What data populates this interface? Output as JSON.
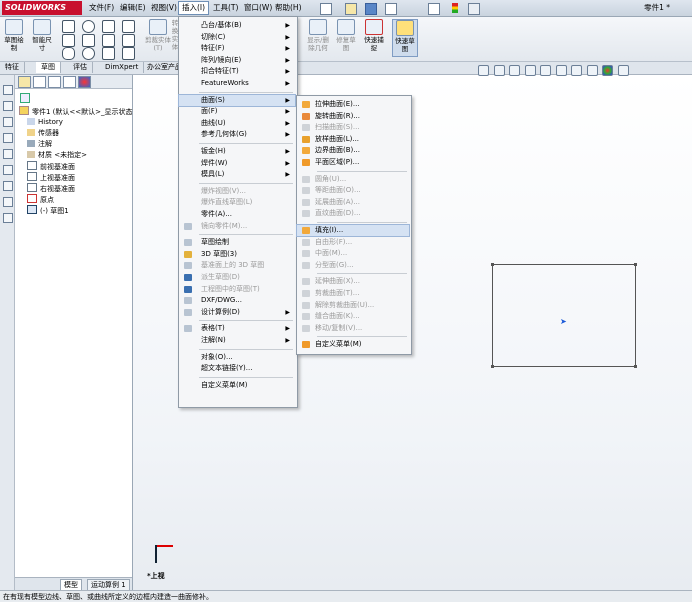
{
  "app": {
    "logo": "SOLIDWORKS",
    "document_title": "零件1 *"
  },
  "menubar": [
    "文件(F)",
    "编辑(E)",
    "视图(V)",
    "插入(I)",
    "工具(T)",
    "窗口(W)",
    "帮助(H)"
  ],
  "commands": {
    "sketch": "草图绘制",
    "smart_dim": "智能尺寸",
    "trim": "剪裁实体(T)",
    "convert": "转换实体",
    "display_delete": "显示/删除几何",
    "repair_sketch": "修复草图",
    "quick_snap": "快速捕捉",
    "rapid_sketch": "快速草图"
  },
  "tabs": [
    "特征",
    "草图",
    "评估",
    "DimXpert",
    "办公室产品"
  ],
  "tree": {
    "root": "零件1 (默认<<默认>_显示状态",
    "items": [
      "History",
      "传感器",
      "注解",
      "材质 <未指定>",
      "前视基准面",
      "上视基准面",
      "右视基准面",
      "原点",
      "(-) 草图1"
    ],
    "bottom_tabs": [
      "模型",
      "运动算例 1"
    ]
  },
  "insert_menu": [
    {
      "label": "凸台/基体(B)",
      "sub": true
    },
    {
      "label": "切除(C)",
      "sub": true
    },
    {
      "label": "特征(F)",
      "sub": true
    },
    {
      "label": "阵列/镜向(E)",
      "sub": true
    },
    {
      "label": "扣合特征(T)",
      "sub": true
    },
    {
      "label": "FeatureWorks",
      "sub": true
    },
    {
      "sep": true
    },
    {
      "label": "曲面(S)",
      "sub": true,
      "hl": true
    },
    {
      "label": "面(F)",
      "sub": true
    },
    {
      "label": "曲线(U)",
      "sub": true
    },
    {
      "label": "参考几何体(G)",
      "sub": true
    },
    {
      "sep": true
    },
    {
      "label": "钣金(H)",
      "sub": true
    },
    {
      "label": "焊件(W)",
      "sub": true
    },
    {
      "label": "模具(L)",
      "sub": true
    },
    {
      "sep": true
    },
    {
      "label": "爆炸视图(V)...",
      "dis": true
    },
    {
      "label": "爆炸直线草图(L)",
      "dis": true
    },
    {
      "label": "零件(A)..."
    },
    {
      "label": "镜向零件(M)...",
      "dis": true
    },
    {
      "sep": true
    },
    {
      "label": "草图绘制"
    },
    {
      "label": "3D 草图(3)"
    },
    {
      "label": "基准面上的 3D 草图",
      "dis": true
    },
    {
      "label": "派生草图(D)",
      "dis": true
    },
    {
      "label": "工程图中的草图(T)",
      "dis": true
    },
    {
      "label": "DXF/DWG..."
    },
    {
      "label": "设计算例(D)",
      "sub": true
    },
    {
      "sep": true
    },
    {
      "label": "表格(T)",
      "sub": true
    },
    {
      "label": "注解(N)",
      "sub": true
    },
    {
      "sep": true
    },
    {
      "label": "对象(O)..."
    },
    {
      "label": "超文本链接(Y)..."
    },
    {
      "sep": true
    },
    {
      "label": "自定义菜单(M)"
    }
  ],
  "surface_menu": [
    {
      "label": "拉伸曲面(E)..."
    },
    {
      "label": "旋转曲面(R)..."
    },
    {
      "label": "扫描曲面(S)...",
      "dis": true
    },
    {
      "label": "放样曲面(L)..."
    },
    {
      "label": "边界曲面(B)..."
    },
    {
      "label": "平面区域(P)..."
    },
    {
      "sep": true
    },
    {
      "label": "圆角(U)...",
      "dis": true
    },
    {
      "label": "等距曲面(O)...",
      "dis": true
    },
    {
      "label": "延展曲面(A)...",
      "dis": true
    },
    {
      "label": "直纹曲面(D)...",
      "dis": true
    },
    {
      "sep": true
    },
    {
      "label": "填充(I)...",
      "hl": true
    },
    {
      "label": "自由形(F)...",
      "dis": true
    },
    {
      "label": "中面(M)...",
      "dis": true
    },
    {
      "label": "分型面(G)...",
      "dis": true
    },
    {
      "sep": true
    },
    {
      "label": "延伸曲面(X)...",
      "dis": true
    },
    {
      "label": "剪裁曲面(T)...",
      "dis": true
    },
    {
      "label": "解除剪裁曲面(U)...",
      "dis": true
    },
    {
      "label": "缝合曲面(K)...",
      "dis": true
    },
    {
      "label": "移动/复制(V)...",
      "dis": true
    },
    {
      "sep": true
    },
    {
      "label": "自定义菜单(M)"
    }
  ],
  "view_orientation": "*上视",
  "status_text": "在有现有模型边线、草图、或曲线所定义的边框内建造一曲面修补。"
}
